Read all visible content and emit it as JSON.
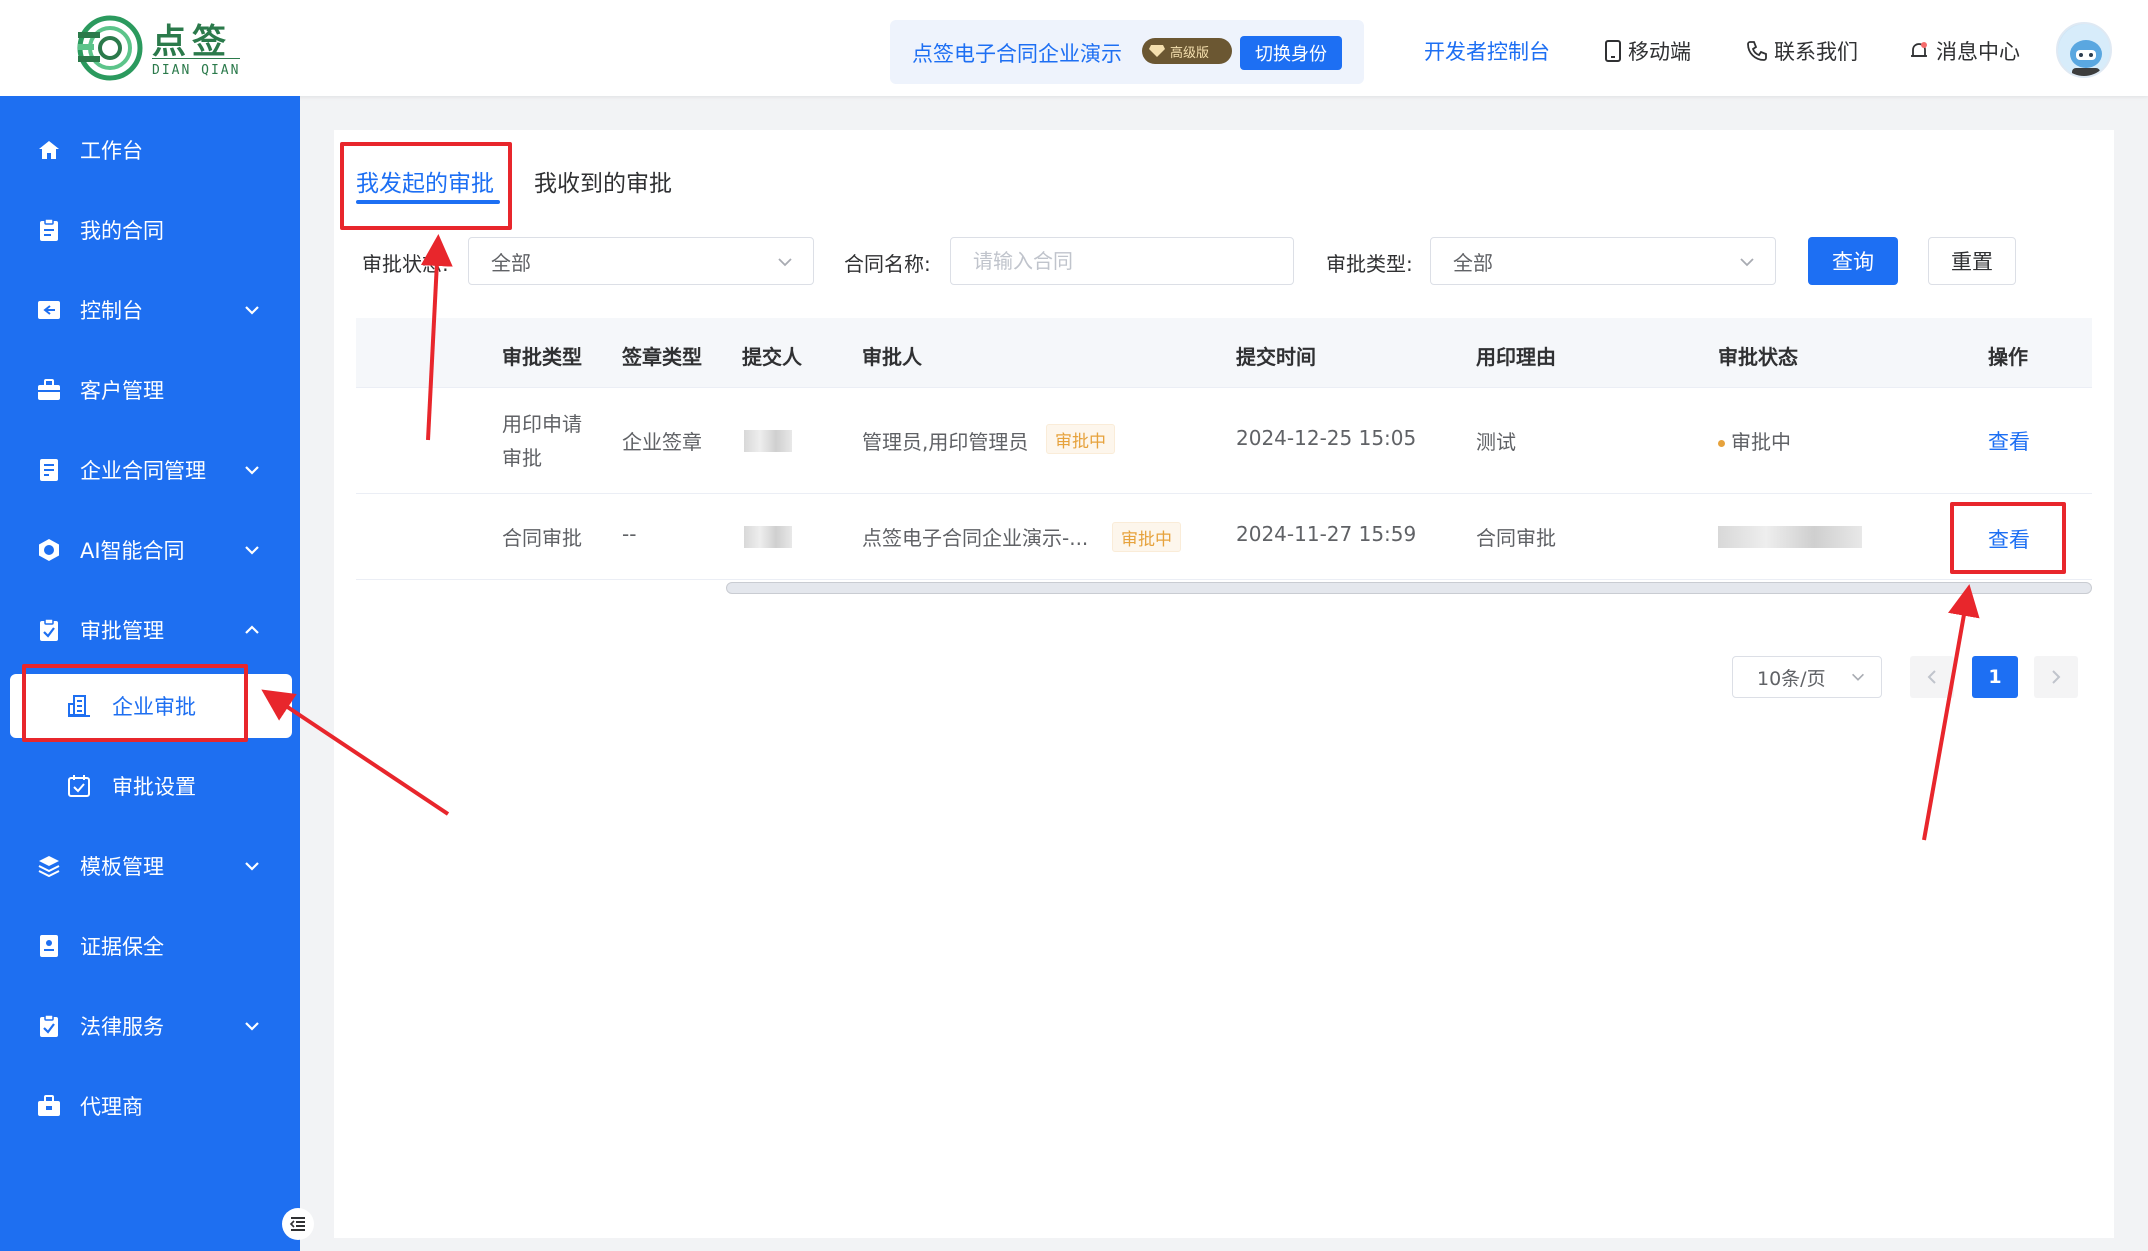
{
  "header": {
    "logo_name": "点签",
    "logo_sub": "DIAN QIAN",
    "company_name": "点签电子合同企业演示",
    "vip_label": "高级版",
    "switch_label": "切换身份",
    "links": {
      "developer": "开发者控制台",
      "mobile": "移动端",
      "contact": "联系我们",
      "messages": "消息中心"
    }
  },
  "sidebar": {
    "items": [
      {
        "label": "工作台",
        "icon": "home-icon"
      },
      {
        "label": "我的合同",
        "icon": "clipboard-icon"
      },
      {
        "label": "控制台",
        "icon": "console-icon"
      },
      {
        "label": "客户管理",
        "icon": "briefcase-icon"
      },
      {
        "label": "企业合同管理",
        "icon": "document-icon"
      },
      {
        "label": "AI智能合同",
        "icon": "ai-hex-icon"
      },
      {
        "label": "审批管理",
        "icon": "approval-icon"
      },
      {
        "label": "企业审批",
        "icon": "building-icon"
      },
      {
        "label": "审批设置",
        "icon": "checkbox-icon"
      },
      {
        "label": "模板管理",
        "icon": "layers-icon"
      },
      {
        "label": "证据保全",
        "icon": "evidence-icon"
      },
      {
        "label": "法律服务",
        "icon": "legal-icon"
      },
      {
        "label": "代理商",
        "icon": "agent-icon"
      }
    ]
  },
  "tabs": [
    "我发起的审批",
    "我收到的审批"
  ],
  "filters": {
    "status_label": "审批状态:",
    "status_value": "全部",
    "name_label": "合同名称:",
    "name_placeholder": "请输入合同",
    "type_label": "审批类型:",
    "type_value": "全部",
    "query_label": "查询",
    "reset_label": "重置"
  },
  "table": {
    "columns": [
      "审批类型",
      "签章类型",
      "提交人",
      "审批人",
      "提交时间",
      "用印理由",
      "审批状态",
      "操作"
    ],
    "rows": [
      {
        "type_line1": "用印申请",
        "type_line2": "审批",
        "seal_type": "企业签章",
        "approver": "管理员,用印管理员",
        "approver_tag": "审批中",
        "submit_time": "2024-12-25 15:05",
        "reason": "测试",
        "status": "审批中",
        "action": "查看"
      },
      {
        "type_line1": "合同审批",
        "seal_type": "--",
        "approver": "点签电子合同企业演示-...",
        "approver_tag": "审批中",
        "submit_time": "2024-11-27 15:59",
        "reason": "合同审批",
        "action": "查看"
      }
    ]
  },
  "pagination": {
    "page_size": "10条/页",
    "current_page": "1"
  },
  "colors": {
    "primary": "#1d6ff3",
    "sidebar": "#1e6ff1",
    "annotation": "#e8262c",
    "pending": "#e6a23c"
  }
}
